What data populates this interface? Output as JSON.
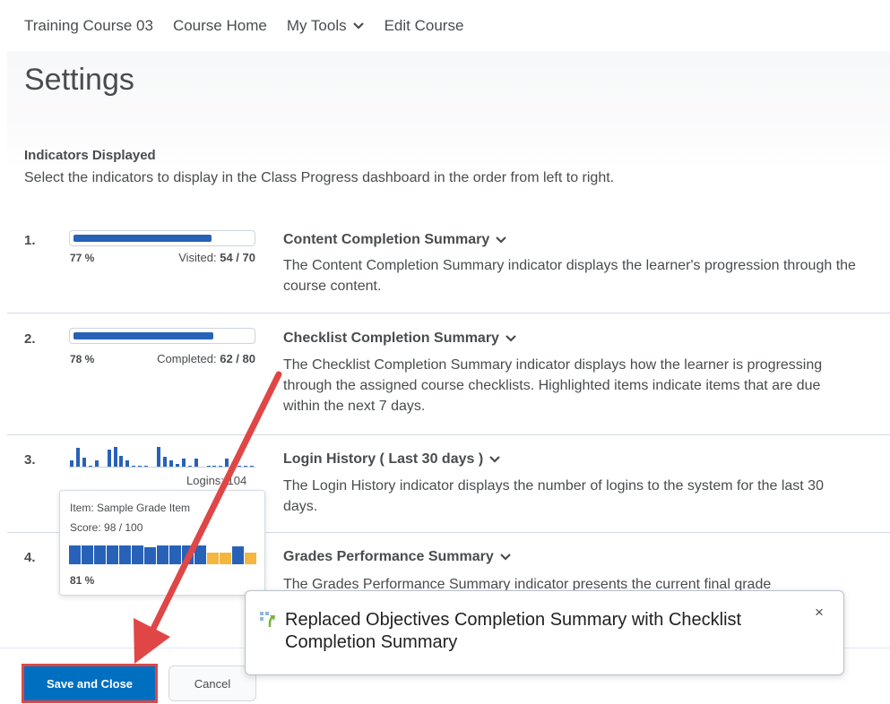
{
  "nav": {
    "course": "Training Course 03",
    "home": "Course Home",
    "tools": "My Tools",
    "edit": "Edit Course"
  },
  "page": {
    "title": "Settings",
    "section_heading": "Indicators Displayed",
    "section_desc": "Select the indicators to display in the Class Progress dashboard in the order from left to right."
  },
  "indicators": [
    {
      "number": "1.",
      "title": "Content Completion Summary",
      "desc": "The Content Completion Summary indicator displays the learner's progression through the course content.",
      "percent_label": "77 %",
      "percent": 77,
      "stat_label": "Visited:",
      "stat_value": "54 / 70"
    },
    {
      "number": "2.",
      "title": "Checklist Completion Summary",
      "desc": "The Checklist Completion Summary indicator displays how the learner is progressing through the assigned course checklists. Highlighted items indicate items that are due within the next 7 days.",
      "percent_label": "78 %",
      "percent": 78,
      "stat_label": "Completed:",
      "stat_value": "62 / 80"
    },
    {
      "number": "3.",
      "title": "Login History ( Last 30 days )",
      "desc": "The Login History indicator displays the number of logins to the system for the last 30 days.",
      "logins_label": "Logins: 104",
      "login_levels": [
        0.35,
        0.9,
        0.45,
        0.1,
        0.35,
        0,
        0.85,
        0.95,
        0.55,
        0.35,
        0.1,
        0.1,
        0.1,
        0,
        0.95,
        0.5,
        0.35,
        0.15,
        0.4,
        0.1,
        0.4,
        0,
        0.1,
        0.1,
        0.1,
        0.4,
        0.1,
        0.1,
        0.1,
        0.1
      ]
    },
    {
      "number": "4.",
      "title": "Grades Performance Summary",
      "desc": "The Grades Performance Summary indicator presents the current final grade",
      "percent_label": "81 %",
      "grade_levels": [
        0.95,
        0.95,
        0.95,
        0.95,
        0.95,
        0.95,
        0.85,
        0.95,
        0.95,
        0.95,
        0.95,
        0.6,
        0.6,
        0.9,
        0.6
      ],
      "grade_highlight": [
        false,
        false,
        false,
        false,
        false,
        false,
        false,
        false,
        false,
        false,
        false,
        true,
        true,
        false,
        true
      ]
    }
  ],
  "tooltip": {
    "item": "Item: Sample Grade Item",
    "score": "Score: 98 / 100"
  },
  "toast": {
    "message": "Replaced Objectives Completion Summary with Checklist Completion Summary",
    "close": "×"
  },
  "buttons": {
    "save": "Save and Close",
    "cancel": "Cancel"
  },
  "colors": {
    "bar_blue": "#2862b8",
    "bar_orange": "#f5b640",
    "primary_button": "#006fbf",
    "annotation_red": "#e04646"
  }
}
